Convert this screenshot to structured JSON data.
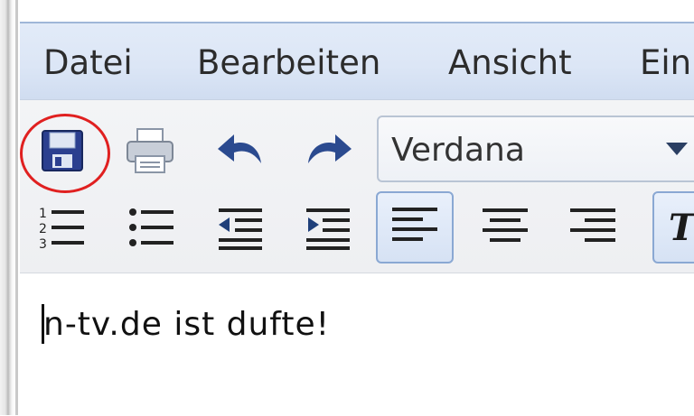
{
  "menu": {
    "items": [
      "Datei",
      "Bearbeiten",
      "Ansicht",
      "Ein"
    ]
  },
  "toolbar": {
    "font_select_value": "Verdana",
    "italic_label": "T",
    "icons": [
      "save-icon",
      "print-icon",
      "undo-icon",
      "redo-icon",
      "ordered-list-icon",
      "unordered-list-icon",
      "outdent-icon",
      "indent-icon",
      "align-left-icon",
      "align-center-icon",
      "align-right-icon",
      "italic-icon"
    ]
  },
  "editor": {
    "text": "n-tv.de ist dufte!"
  },
  "colors": {
    "menubar_bg": "#dce6f6",
    "highlight_circle": "#e02020",
    "icon_blue": "#2b4a8f"
  }
}
